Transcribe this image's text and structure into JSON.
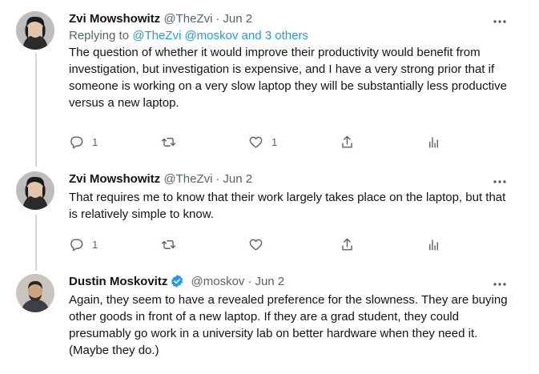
{
  "tweets": [
    {
      "name": "Zvi Mowshowitz",
      "handle": "@TheZvi",
      "sep": "·",
      "date": "Jun 2",
      "replying_prefix": "Replying to ",
      "replying_to": "@TheZvi @moskov and 3 others",
      "text": "The question of whether it would improve their productivity would benefit from investigation, but investigation is expensive, and I have a very strong prior that if someone is working on a very slow laptop they will be substantially less productive versus a new laptop.",
      "replies": "1",
      "retweets": "",
      "likes": "1",
      "verified": false
    },
    {
      "name": "Zvi Mowshowitz",
      "handle": "@TheZvi",
      "sep": "·",
      "date": "Jun 2",
      "text": "That requires me to know that their work largely takes place on the laptop, but that is relatively simple to know.",
      "replies": "1",
      "retweets": "",
      "likes": "",
      "verified": false
    },
    {
      "name": "Dustin Moskovitz",
      "handle": "@moskov",
      "sep": "·",
      "date": "Jun 2",
      "text": "Again, they seem to have a revealed preference for the slowness. They are buying other goods in front of a new laptop. If they are a grad student, they could presumably go work in a university lab on better hardware when they need it. (Maybe they do.)",
      "verified": true
    }
  ],
  "icons": {
    "reply": "reply-icon",
    "retweet": "retweet-icon",
    "like": "heart-icon",
    "share": "share-icon",
    "analytics": "analytics-icon",
    "more": "more-icon"
  },
  "colors": {
    "link": "#1d9bf0",
    "secondary": "#536471",
    "thread_line": "#cfd9de",
    "verified": "#1d9bf0"
  }
}
